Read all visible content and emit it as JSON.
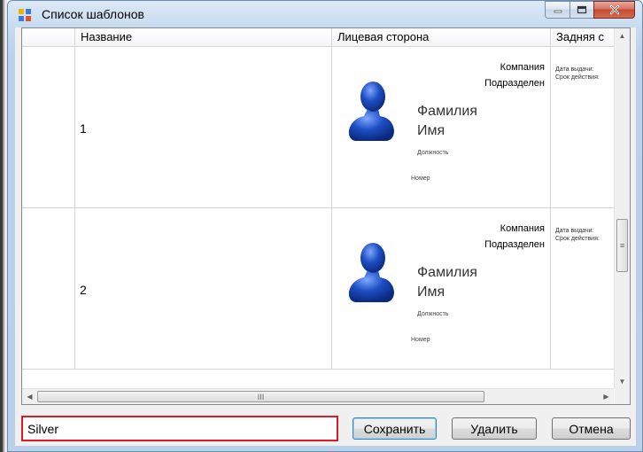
{
  "window": {
    "title": "Список шаблонов",
    "caption_buttons": {
      "minimize_icon": "minimize-icon",
      "maximize_icon": "maximize-icon",
      "close_icon": "close-icon"
    }
  },
  "grid": {
    "columns": [
      "Название",
      "Лицевая сторона",
      "Задняя с"
    ],
    "rows": [
      {
        "name": "1",
        "front": {
          "company": "Компания",
          "department": "Подразделен",
          "surname": "Фамилия",
          "firstname": "Имя",
          "position": "Должность",
          "number": "Номер"
        },
        "back": {
          "line1": "Дата выдачи:",
          "line2": "Срок действия:"
        }
      },
      {
        "name": "2",
        "front": {
          "company": "Компания",
          "department": "Подразделен",
          "surname": "Фамилия",
          "firstname": "Имя",
          "position": "Должность",
          "number": "Номер"
        },
        "back": {
          "line1": "Дата выдачи:",
          "line2": "Срок действия:"
        }
      }
    ],
    "scrollbar_grip": "III"
  },
  "footer": {
    "name_value": "Silver",
    "save_label": "Сохранить",
    "delete_label": "Удалить",
    "cancel_label": "Отмена"
  },
  "colors": {
    "highlight_border": "#e01b24",
    "avatar": "#1f4fc4"
  }
}
